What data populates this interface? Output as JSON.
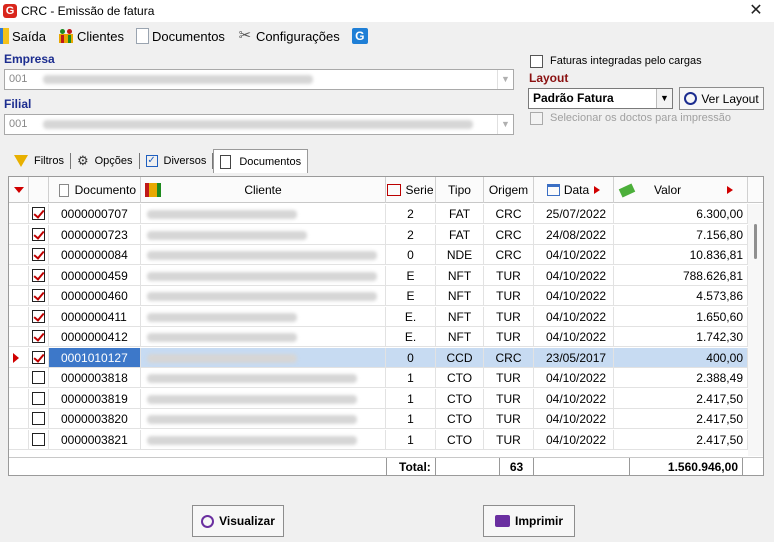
{
  "window": {
    "title": "CRC - Emissão de fatura",
    "logo": "G"
  },
  "menu": [
    {
      "label": "Saída",
      "icon": "exit-icon"
    },
    {
      "label": "Clientes",
      "icon": "clients-icon"
    },
    {
      "label": "Documentos",
      "icon": "document-icon"
    },
    {
      "label": "Configurações",
      "icon": "tools-icon"
    },
    {
      "label": "",
      "icon": "info-icon"
    }
  ],
  "form": {
    "empresa_label": "Empresa",
    "empresa_value": "001",
    "filial_label": "Filial",
    "filial_value": "001",
    "faturas_integradas_label": "Faturas integradas pelo cargas",
    "layout_label": "Layout",
    "layout_value": "Padrão Fatura",
    "ver_layout_label": "Ver Layout",
    "selecionar_label": "Selecionar os doctos para impressão"
  },
  "tabs": [
    {
      "label": "Filtros"
    },
    {
      "label": "Opções"
    },
    {
      "label": "Diversos"
    },
    {
      "label": "Documentos"
    }
  ],
  "grid": {
    "headers": {
      "documento": "Documento",
      "cliente": "Cliente",
      "serie": "Serie",
      "tipo": "Tipo",
      "origem": "Origem",
      "data": "Data",
      "valor": "Valor"
    },
    "rows": [
      {
        "checked": true,
        "documento": "0000000707",
        "serie": "2",
        "tipo": "FAT",
        "origem": "CRC",
        "data": "25/07/2022",
        "valor": "6.300,00"
      },
      {
        "checked": true,
        "documento": "0000000723",
        "serie": "2",
        "tipo": "FAT",
        "origem": "CRC",
        "data": "24/08/2022",
        "valor": "7.156,80"
      },
      {
        "checked": true,
        "documento": "0000000084",
        "serie": "0",
        "tipo": "NDE",
        "origem": "CRC",
        "data": "04/10/2022",
        "valor": "10.836,81"
      },
      {
        "checked": true,
        "documento": "0000000459",
        "serie": "E",
        "tipo": "NFT",
        "origem": "TUR",
        "data": "04/10/2022",
        "valor": "788.626,81"
      },
      {
        "checked": true,
        "documento": "0000000460",
        "serie": "E",
        "tipo": "NFT",
        "origem": "TUR",
        "data": "04/10/2022",
        "valor": "4.573,86"
      },
      {
        "checked": true,
        "documento": "0000000411",
        "serie": "E.",
        "tipo": "NFT",
        "origem": "TUR",
        "data": "04/10/2022",
        "valor": "1.650,60"
      },
      {
        "checked": true,
        "documento": "0000000412",
        "serie": "E.",
        "tipo": "NFT",
        "origem": "TUR",
        "data": "04/10/2022",
        "valor": "1.742,30"
      },
      {
        "checked": true,
        "documento": "0001010127",
        "serie": "0",
        "tipo": "CCD",
        "origem": "CRC",
        "data": "23/05/2017",
        "valor": "400,00",
        "selected": true
      },
      {
        "checked": false,
        "documento": "0000003818",
        "serie": "1",
        "tipo": "CTO",
        "origem": "TUR",
        "data": "04/10/2022",
        "valor": "2.388,49"
      },
      {
        "checked": false,
        "documento": "0000003819",
        "serie": "1",
        "tipo": "CTO",
        "origem": "TUR",
        "data": "04/10/2022",
        "valor": "2.417,50"
      },
      {
        "checked": false,
        "documento": "0000003820",
        "serie": "1",
        "tipo": "CTO",
        "origem": "TUR",
        "data": "04/10/2022",
        "valor": "2.417,50"
      },
      {
        "checked": false,
        "documento": "0000003821",
        "serie": "1",
        "tipo": "CTO",
        "origem": "TUR",
        "data": "04/10/2022",
        "valor": "2.417,50"
      }
    ],
    "footer": {
      "total_label": "Total:",
      "count": "63",
      "sum": "1.560.946,00"
    }
  },
  "buttons": {
    "visualizar": "Visualizar",
    "imprimir": "Imprimir"
  },
  "colors": {
    "accent_blue": "#1c2d8f",
    "accent_red": "#8a1010",
    "selection": "#c7dbf2",
    "check_red": "#c00000"
  }
}
